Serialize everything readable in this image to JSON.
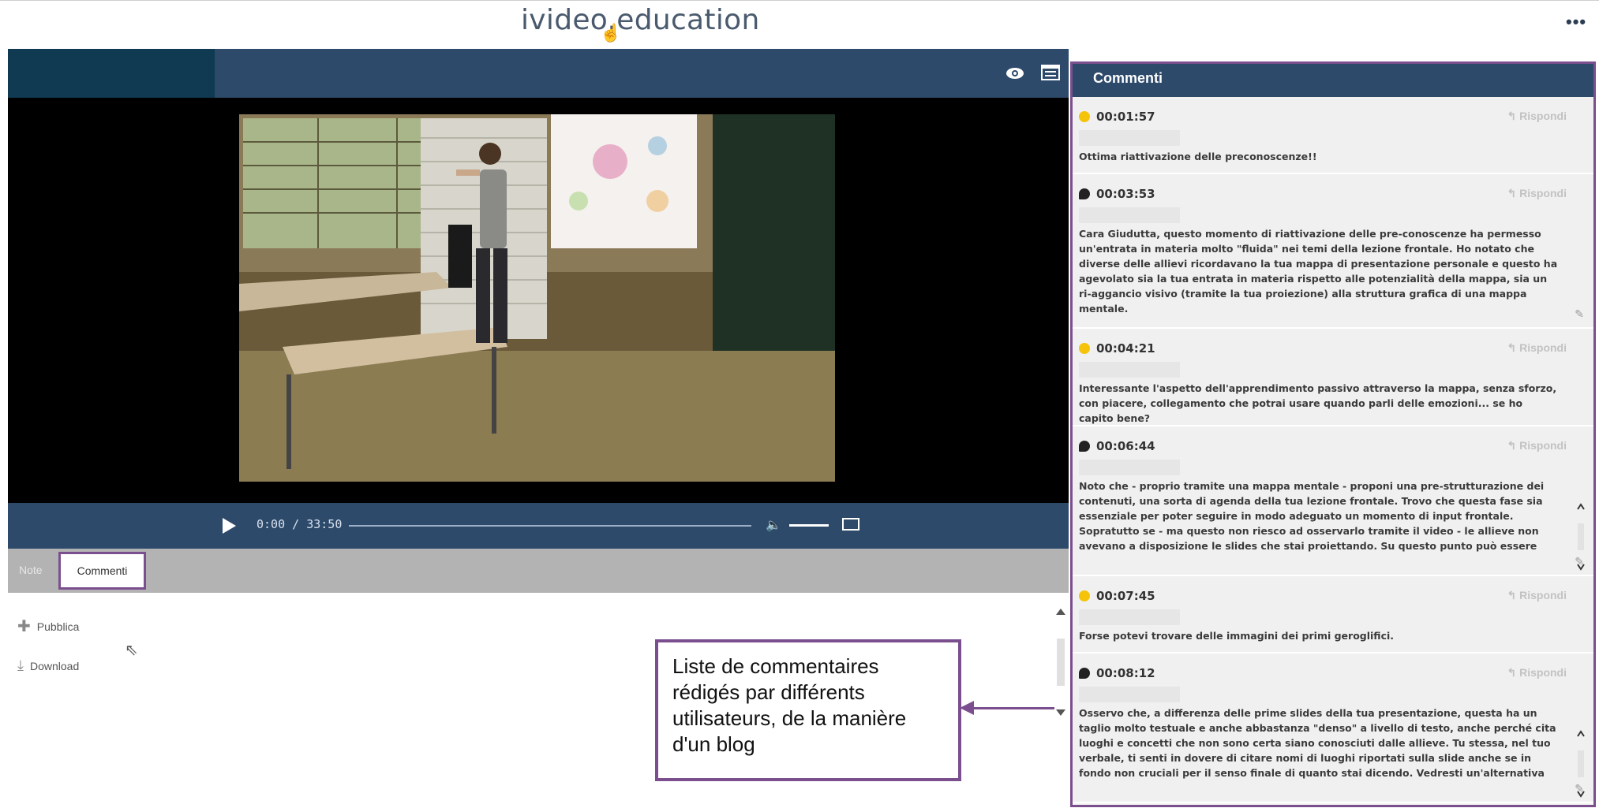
{
  "header": {
    "brand": "ivideo.education",
    "more_label": "•••"
  },
  "player": {
    "time_display": "0:00 / 33:50",
    "progress_fraction": 0
  },
  "tabs": {
    "note_label": "Note",
    "commenti_label": "Commenti"
  },
  "actions": {
    "pubblica_label": "Pubblica",
    "download_label": "Download"
  },
  "callout": {
    "text": "Liste de commentaires rédigés par différents utilisateurs, de la manière d'un blog"
  },
  "comments_panel": {
    "title": "Commenti",
    "reply_label": "Rispondi",
    "items": [
      {
        "marker": "yellow",
        "time": "00:01:57",
        "text": "Ottima riattivazione delle preconoscenze!!"
      },
      {
        "marker": "bubble",
        "time": "00:03:53",
        "text": "Cara Giudutta, questo momento di riattivazione delle pre-conoscenze ha permesso un'entrata in materia molto \"fluida\" nei temi della lezione frontale. Ho notato che diverse delle allievi ricordavano la tua mappa di presentazione personale e questo ha agevolato sia la tua entrata in materia rispetto alle potenzialità della mappa, sia un ri-aggancio visivo (tramite la tua proiezione) alla struttura grafica di una mappa mentale."
      },
      {
        "marker": "yellow",
        "time": "00:04:21",
        "text": "Interessante l'aspetto dell'apprendimento passivo attraverso la mappa, senza sforzo, con piacere, collegamento che potrai usare quando parli delle emozioni... se ho capito bene?"
      },
      {
        "marker": "bubble",
        "time": "00:06:44",
        "text": "Noto che - proprio tramite una mappa mentale - proponi una pre-strutturazione dei contenuti, una sorta di agenda della tua lezione frontale. Trovo che questa fase sia essenziale per poter seguire in modo adeguato un momento di input frontale. Sopratutto se - ma questo non riesco ad osservarlo tramite il video - le allieve non avevano a disposizione le slides che stai proiettando. Su questo punto può essere"
      },
      {
        "marker": "yellow",
        "time": "00:07:45",
        "text": "Forse potevi trovare delle immagini dei primi geroglifici."
      },
      {
        "marker": "bubble",
        "time": "00:08:12",
        "text": "Osservo che, a differenza delle prime slides della tua presentazione, questa ha un taglio molto testuale e anche abbastanza \"denso\" a livello di testo, anche perché cita luoghi e concetti che non sono certa siano conosciuti dalle allieve. Tu stessa, nel tuo verbale, ti senti in dovere di citare nomi di luoghi riportati sulla slide anche se in fondo non cruciali per il senso finale di quanto stai dicendo. Vedresti un'alternativa possibile"
      }
    ]
  },
  "icons": {
    "eye": "eye-icon",
    "list": "list-icon",
    "play": "play-icon",
    "volume": "volume-icon",
    "fullscreen": "fullscreen-icon",
    "plus": "plus-icon",
    "download": "download-icon",
    "reply": "reply-icon",
    "edit": "edit-icon"
  },
  "colors": {
    "bar_blue": "#2d4a6b",
    "dark_teal": "#0f3a52",
    "accent_purple": "#7b4f8e",
    "marker_yellow": "#f5c30a"
  }
}
